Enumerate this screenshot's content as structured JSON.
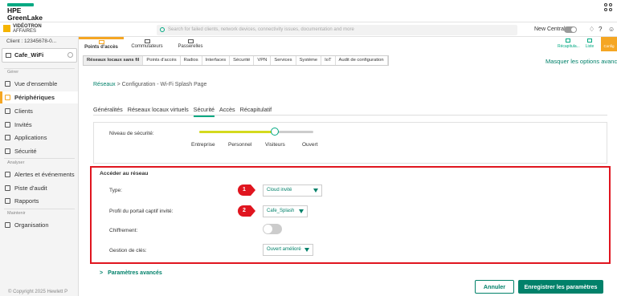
{
  "brand": {
    "hpe": "HPE",
    "greenlake": "GreenLake",
    "videotron_line1": "VIDÉOTRON",
    "videotron_line2": "AFFAIRES"
  },
  "search": {
    "placeholder": "Search for failed clients, network devices, connectivity issues, documentation and more"
  },
  "header": {
    "new_central": "New Central"
  },
  "sidebar": {
    "client": "Client : 12345678-0...",
    "site": "Cafe_WiFi",
    "section_gerer": "Gérer",
    "section_analyser": "Analyser",
    "section_maintenir": "Maintenir",
    "items": [
      {
        "label": "Vue d'ensemble"
      },
      {
        "label": "Périphériques"
      },
      {
        "label": "Clients"
      },
      {
        "label": "Invités"
      },
      {
        "label": "Applications"
      },
      {
        "label": "Sécurité"
      },
      {
        "label": "Alertes et événements"
      },
      {
        "label": "Piste d'audit"
      },
      {
        "label": "Rapports"
      },
      {
        "label": "Organisation"
      }
    ]
  },
  "device_tabs": [
    {
      "label": "Points d'accès"
    },
    {
      "label": "Commutateurs"
    },
    {
      "label": "Passerelles"
    }
  ],
  "right_tools": {
    "recap": "Récapitula...",
    "liste": "Liste",
    "config": "Config"
  },
  "sub_tabs": [
    "Réseaux locaux sans fil",
    "Points d'accès",
    "Radios",
    "Interfaces",
    "Sécurité",
    "VPN",
    "Services",
    "Système",
    "IoT",
    "Audit de configuration"
  ],
  "masquer": "Masquer les options avancées",
  "breadcrumb": {
    "root": "Réseaux",
    "rest": " > Configuration - Wi-Fi Splash Page"
  },
  "wizard_tabs": [
    "Généralités",
    "Réseaux locaux virtuels",
    "Sécurité",
    "Accès",
    "Récapitulatif"
  ],
  "security_level": {
    "label": "Niveau de sécurité:",
    "stops": [
      "Entreprise",
      "Personnel",
      "Visiteurs",
      "Ouvert"
    ],
    "selected": "Visiteurs"
  },
  "access": {
    "title": "Accéder au réseau",
    "type_label": "Type:",
    "type_value": "Cloud invité",
    "profile_label": "Profil du portail captif invité:",
    "profile_value": "Cafe_Splash",
    "encryption_label": "Chiffrement:",
    "encryption_on": false,
    "keymgmt_label": "Gestion de clés:",
    "keymgmt_value": "Ouvert amélioré",
    "marker1": "1",
    "marker2": "2"
  },
  "advanced": "Paramètres avancés",
  "footer": "© Copyright 2025 Hewlett P",
  "buttons": {
    "cancel": "Annuler",
    "save": "Enregistrer les paramètres"
  }
}
